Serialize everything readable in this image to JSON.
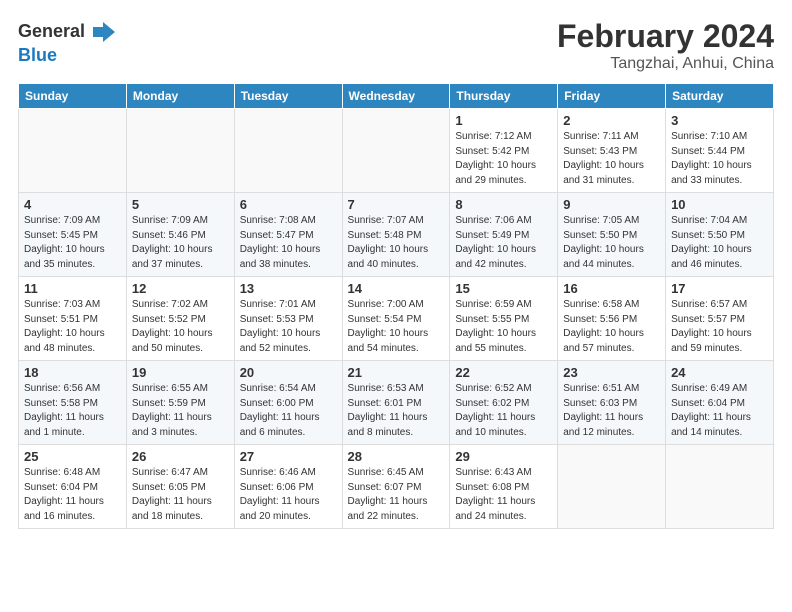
{
  "header": {
    "logo_general": "General",
    "logo_blue": "Blue",
    "month_title": "February 2024",
    "subtitle": "Tangzhai, Anhui, China"
  },
  "weekdays": [
    "Sunday",
    "Monday",
    "Tuesday",
    "Wednesday",
    "Thursday",
    "Friday",
    "Saturday"
  ],
  "weeks": [
    [
      {
        "day": "",
        "info": ""
      },
      {
        "day": "",
        "info": ""
      },
      {
        "day": "",
        "info": ""
      },
      {
        "day": "",
        "info": ""
      },
      {
        "day": "1",
        "info": "Sunrise: 7:12 AM\nSunset: 5:42 PM\nDaylight: 10 hours\nand 29 minutes."
      },
      {
        "day": "2",
        "info": "Sunrise: 7:11 AM\nSunset: 5:43 PM\nDaylight: 10 hours\nand 31 minutes."
      },
      {
        "day": "3",
        "info": "Sunrise: 7:10 AM\nSunset: 5:44 PM\nDaylight: 10 hours\nand 33 minutes."
      }
    ],
    [
      {
        "day": "4",
        "info": "Sunrise: 7:09 AM\nSunset: 5:45 PM\nDaylight: 10 hours\nand 35 minutes."
      },
      {
        "day": "5",
        "info": "Sunrise: 7:09 AM\nSunset: 5:46 PM\nDaylight: 10 hours\nand 37 minutes."
      },
      {
        "day": "6",
        "info": "Sunrise: 7:08 AM\nSunset: 5:47 PM\nDaylight: 10 hours\nand 38 minutes."
      },
      {
        "day": "7",
        "info": "Sunrise: 7:07 AM\nSunset: 5:48 PM\nDaylight: 10 hours\nand 40 minutes."
      },
      {
        "day": "8",
        "info": "Sunrise: 7:06 AM\nSunset: 5:49 PM\nDaylight: 10 hours\nand 42 minutes."
      },
      {
        "day": "9",
        "info": "Sunrise: 7:05 AM\nSunset: 5:50 PM\nDaylight: 10 hours\nand 44 minutes."
      },
      {
        "day": "10",
        "info": "Sunrise: 7:04 AM\nSunset: 5:50 PM\nDaylight: 10 hours\nand 46 minutes."
      }
    ],
    [
      {
        "day": "11",
        "info": "Sunrise: 7:03 AM\nSunset: 5:51 PM\nDaylight: 10 hours\nand 48 minutes."
      },
      {
        "day": "12",
        "info": "Sunrise: 7:02 AM\nSunset: 5:52 PM\nDaylight: 10 hours\nand 50 minutes."
      },
      {
        "day": "13",
        "info": "Sunrise: 7:01 AM\nSunset: 5:53 PM\nDaylight: 10 hours\nand 52 minutes."
      },
      {
        "day": "14",
        "info": "Sunrise: 7:00 AM\nSunset: 5:54 PM\nDaylight: 10 hours\nand 54 minutes."
      },
      {
        "day": "15",
        "info": "Sunrise: 6:59 AM\nSunset: 5:55 PM\nDaylight: 10 hours\nand 55 minutes."
      },
      {
        "day": "16",
        "info": "Sunrise: 6:58 AM\nSunset: 5:56 PM\nDaylight: 10 hours\nand 57 minutes."
      },
      {
        "day": "17",
        "info": "Sunrise: 6:57 AM\nSunset: 5:57 PM\nDaylight: 10 hours\nand 59 minutes."
      }
    ],
    [
      {
        "day": "18",
        "info": "Sunrise: 6:56 AM\nSunset: 5:58 PM\nDaylight: 11 hours\nand 1 minute."
      },
      {
        "day": "19",
        "info": "Sunrise: 6:55 AM\nSunset: 5:59 PM\nDaylight: 11 hours\nand 3 minutes."
      },
      {
        "day": "20",
        "info": "Sunrise: 6:54 AM\nSunset: 6:00 PM\nDaylight: 11 hours\nand 6 minutes."
      },
      {
        "day": "21",
        "info": "Sunrise: 6:53 AM\nSunset: 6:01 PM\nDaylight: 11 hours\nand 8 minutes."
      },
      {
        "day": "22",
        "info": "Sunrise: 6:52 AM\nSunset: 6:02 PM\nDaylight: 11 hours\nand 10 minutes."
      },
      {
        "day": "23",
        "info": "Sunrise: 6:51 AM\nSunset: 6:03 PM\nDaylight: 11 hours\nand 12 minutes."
      },
      {
        "day": "24",
        "info": "Sunrise: 6:49 AM\nSunset: 6:04 PM\nDaylight: 11 hours\nand 14 minutes."
      }
    ],
    [
      {
        "day": "25",
        "info": "Sunrise: 6:48 AM\nSunset: 6:04 PM\nDaylight: 11 hours\nand 16 minutes."
      },
      {
        "day": "26",
        "info": "Sunrise: 6:47 AM\nSunset: 6:05 PM\nDaylight: 11 hours\nand 18 minutes."
      },
      {
        "day": "27",
        "info": "Sunrise: 6:46 AM\nSunset: 6:06 PM\nDaylight: 11 hours\nand 20 minutes."
      },
      {
        "day": "28",
        "info": "Sunrise: 6:45 AM\nSunset: 6:07 PM\nDaylight: 11 hours\nand 22 minutes."
      },
      {
        "day": "29",
        "info": "Sunrise: 6:43 AM\nSunset: 6:08 PM\nDaylight: 11 hours\nand 24 minutes."
      },
      {
        "day": "",
        "info": ""
      },
      {
        "day": "",
        "info": ""
      }
    ]
  ]
}
